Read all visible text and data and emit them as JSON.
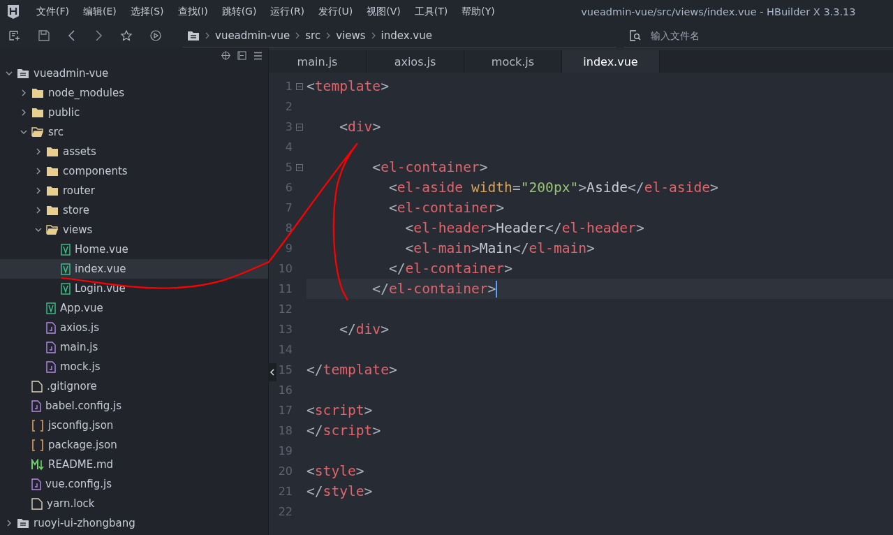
{
  "menu": [
    "文件(F)",
    "编辑(E)",
    "选择(S)",
    "查找(I)",
    "跳转(G)",
    "运行(R)",
    "发行(U)",
    "视图(V)",
    "工具(T)",
    "帮助(Y)"
  ],
  "window": {
    "title": "vueadmin-vue/src/views/index.vue - HBuilder X 3.3.13"
  },
  "breadcrumb": [
    "vueadmin-vue",
    "src",
    "views",
    "index.vue"
  ],
  "file_search": {
    "placeholder": "输入文件名"
  },
  "tree": [
    {
      "label": "vueadmin-vue",
      "kind": "project",
      "expanded": true,
      "selected": false,
      "children": [
        {
          "label": "node_modules",
          "kind": "folder",
          "expanded": false,
          "selected": false
        },
        {
          "label": "public",
          "kind": "folder",
          "expanded": false,
          "selected": false
        },
        {
          "label": "src",
          "kind": "folder",
          "expanded": true,
          "selected": false,
          "children": [
            {
              "label": "assets",
              "kind": "folder",
              "expanded": false,
              "selected": false
            },
            {
              "label": "components",
              "kind": "folder",
              "expanded": false,
              "selected": false
            },
            {
              "label": "router",
              "kind": "folder",
              "expanded": false,
              "selected": false
            },
            {
              "label": "store",
              "kind": "folder",
              "expanded": false,
              "selected": false
            },
            {
              "label": "views",
              "kind": "folder",
              "expanded": true,
              "selected": false,
              "children": [
                {
                  "label": "Home.vue",
                  "kind": "vue",
                  "selected": false
                },
                {
                  "label": "index.vue",
                  "kind": "vue",
                  "selected": true
                },
                {
                  "label": "Login.vue",
                  "kind": "vue",
                  "selected": false
                }
              ]
            },
            {
              "label": "App.vue",
              "kind": "vue",
              "selected": false
            },
            {
              "label": "axios.js",
              "kind": "js",
              "selected": false
            },
            {
              "label": "main.js",
              "kind": "js",
              "selected": false
            },
            {
              "label": "mock.js",
              "kind": "js",
              "selected": false
            }
          ]
        },
        {
          "label": ".gitignore",
          "kind": "file",
          "selected": false
        },
        {
          "label": "babel.config.js",
          "kind": "js",
          "selected": false
        },
        {
          "label": "jsconfig.json",
          "kind": "json",
          "selected": false
        },
        {
          "label": "package.json",
          "kind": "json",
          "selected": false
        },
        {
          "label": "README.md",
          "kind": "md",
          "selected": false
        },
        {
          "label": "vue.config.js",
          "kind": "js",
          "selected": false
        },
        {
          "label": "yarn.lock",
          "kind": "file",
          "selected": false
        }
      ]
    },
    {
      "label": "ruoyi-ui-zhongbang",
      "kind": "project",
      "expanded": false,
      "selected": false
    }
  ],
  "tabs": [
    {
      "label": "main.js",
      "selected": false
    },
    {
      "label": "axios.js",
      "selected": false
    },
    {
      "label": "mock.js",
      "selected": false
    },
    {
      "label": "index.vue",
      "selected": true
    }
  ],
  "code": [
    {
      "number": "1",
      "fold": true,
      "current": false,
      "tokens": [
        {
          "kind": "punct",
          "text": "<"
        },
        {
          "kind": "tag",
          "text": "template"
        },
        {
          "kind": "punct",
          "text": ">"
        }
      ]
    },
    {
      "number": "2",
      "fold": false,
      "current": false
    },
    {
      "number": "3",
      "fold": true,
      "current": false,
      "tokens": [
        {
          "kind": "punct",
          "text": "    <"
        },
        {
          "kind": "tag",
          "text": "div"
        },
        {
          "kind": "punct",
          "text": ">"
        }
      ]
    },
    {
      "number": "4",
      "fold": false,
      "current": false
    },
    {
      "number": "5",
      "fold": true,
      "current": false,
      "tokens": [
        {
          "kind": "punct",
          "text": "        <"
        },
        {
          "kind": "tag",
          "text": "el-container"
        },
        {
          "kind": "punct",
          "text": ">"
        }
      ]
    },
    {
      "number": "6",
      "fold": false,
      "current": false,
      "tokens": [
        {
          "kind": "punct",
          "text": "          <"
        },
        {
          "kind": "tag",
          "text": "el-aside"
        },
        {
          "kind": "attr",
          "text": " width"
        },
        {
          "kind": "punct",
          "text": "="
        },
        {
          "kind": "string",
          "text": "\"200px\""
        },
        {
          "kind": "punct",
          "text": ">"
        },
        {
          "kind": "text",
          "text": "Aside"
        },
        {
          "kind": "punct",
          "text": "</"
        },
        {
          "kind": "tag",
          "text": "el-aside"
        },
        {
          "kind": "punct",
          "text": ">"
        }
      ]
    },
    {
      "number": "7",
      "fold": false,
      "current": false,
      "tokens": [
        {
          "kind": "punct",
          "text": "          <"
        },
        {
          "kind": "tag",
          "text": "el-container"
        },
        {
          "kind": "punct",
          "text": ">"
        }
      ]
    },
    {
      "number": "8",
      "fold": false,
      "current": false,
      "tokens": [
        {
          "kind": "punct",
          "text": "            <"
        },
        {
          "kind": "tag",
          "text": "el-header"
        },
        {
          "kind": "punct",
          "text": ">"
        },
        {
          "kind": "text",
          "text": "Header"
        },
        {
          "kind": "punct",
          "text": "</"
        },
        {
          "kind": "tag",
          "text": "el-header"
        },
        {
          "kind": "punct",
          "text": ">"
        }
      ]
    },
    {
      "number": "9",
      "fold": false,
      "current": false,
      "tokens": [
        {
          "kind": "punct",
          "text": "            <"
        },
        {
          "kind": "tag",
          "text": "el-main"
        },
        {
          "kind": "punct",
          "text": ">"
        },
        {
          "kind": "text",
          "text": "Main"
        },
        {
          "kind": "punct",
          "text": "</"
        },
        {
          "kind": "tag",
          "text": "el-main"
        },
        {
          "kind": "punct",
          "text": ">"
        }
      ]
    },
    {
      "number": "10",
      "fold": false,
      "current": false,
      "tokens": [
        {
          "kind": "punct",
          "text": "          </"
        },
        {
          "kind": "tag",
          "text": "el-container"
        },
        {
          "kind": "punct",
          "text": ">"
        }
      ]
    },
    {
      "number": "11",
      "fold": false,
      "current": true,
      "tokens": [
        {
          "kind": "punct",
          "text": "        </"
        },
        {
          "kind": "tag",
          "text": "el-container"
        },
        {
          "kind": "punct",
          "text": ">"
        }
      ]
    },
    {
      "number": "12",
      "fold": false,
      "current": false
    },
    {
      "number": "13",
      "fold": false,
      "current": false,
      "tokens": [
        {
          "kind": "punct",
          "text": "    </"
        },
        {
          "kind": "tag",
          "text": "div"
        },
        {
          "kind": "punct",
          "text": ">"
        }
      ]
    },
    {
      "number": "14",
      "fold": false,
      "current": false
    },
    {
      "number": "15",
      "fold": false,
      "current": false,
      "tokens": [
        {
          "kind": "punct",
          "text": "</"
        },
        {
          "kind": "tag",
          "text": "template"
        },
        {
          "kind": "punct",
          "text": ">"
        }
      ]
    },
    {
      "number": "16",
      "fold": false,
      "current": false
    },
    {
      "number": "17",
      "fold": false,
      "current": false,
      "tokens": [
        {
          "kind": "punct",
          "text": "<"
        },
        {
          "kind": "tag",
          "text": "script"
        },
        {
          "kind": "punct",
          "text": ">"
        }
      ]
    },
    {
      "number": "18",
      "fold": false,
      "current": false,
      "tokens": [
        {
          "kind": "punct",
          "text": "</"
        },
        {
          "kind": "tag",
          "text": "script"
        },
        {
          "kind": "punct",
          "text": ">"
        }
      ]
    },
    {
      "number": "19",
      "fold": false,
      "current": false
    },
    {
      "number": "20",
      "fold": false,
      "current": false,
      "tokens": [
        {
          "kind": "punct",
          "text": "<"
        },
        {
          "kind": "tag",
          "text": "style"
        },
        {
          "kind": "punct",
          "text": ">"
        }
      ]
    },
    {
      "number": "21",
      "fold": false,
      "current": false,
      "tokens": [
        {
          "kind": "punct",
          "text": "</"
        },
        {
          "kind": "tag",
          "text": "style"
        },
        {
          "kind": "punct",
          "text": ">"
        }
      ]
    },
    {
      "number": "22",
      "fold": false,
      "current": false
    }
  ]
}
